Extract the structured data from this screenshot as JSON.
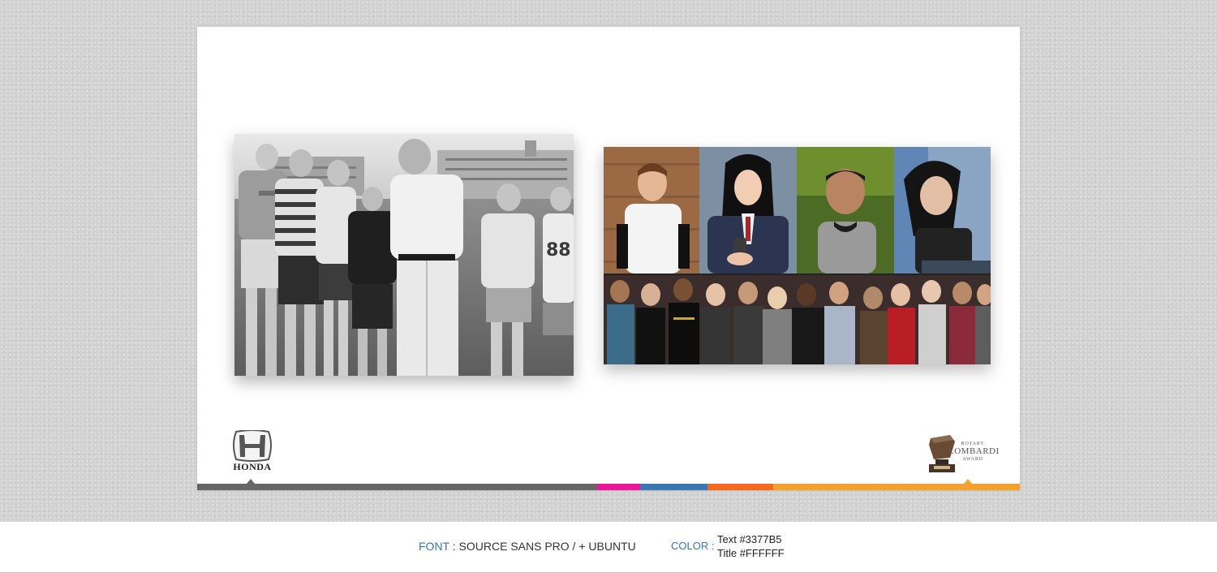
{
  "slide": {
    "left_photo": {
      "description_icon": "coach-with-boys-photo"
    },
    "right_photo": {
      "description_icon": "youth-collage-photo"
    },
    "honda_logo": {
      "text": "HONDA"
    },
    "lombardi_logo": {
      "line1": "ROTARY",
      "line2": "LOMBARDI",
      "line3": "AWARD"
    },
    "bar_colors": [
      "#666666",
      "#e6199b",
      "#3a77b5",
      "#f26a1b",
      "#f3a12a"
    ]
  },
  "footer": {
    "font_label": "FONT",
    "font_sep": " : ",
    "font_value": "SOURCE SANS PRO / + UBUNTU",
    "color_label": "COLOR :",
    "color_text": "Text #3377B5",
    "color_title": "Title #FFFFFF"
  },
  "colors": {
    "accent_text": "#3377B5",
    "title": "#FFFFFF"
  }
}
